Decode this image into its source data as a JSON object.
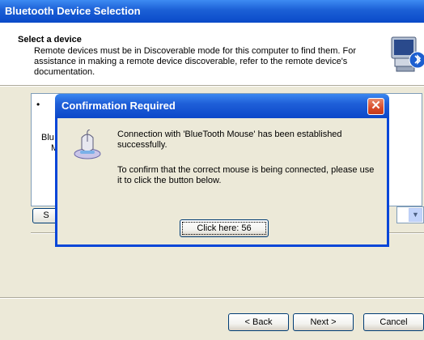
{
  "wizard": {
    "title": "Bluetooth Device Selection",
    "header_title": "Select a device",
    "header_text": "Remote devices must be in Discoverable mode for this computer to find them. For assistance in making a remote device discoverable, refer to the remote device's documentation.",
    "list_fragment_1": "Blu",
    "list_fragment_2": "M",
    "under_button_label": "S",
    "back_label": "< Back",
    "next_label": "Next >",
    "cancel_label": "Cancel"
  },
  "dialog": {
    "title": "Confirmation Required",
    "message_1": "Connection with 'BlueTooth Mouse' has been established successfully.",
    "message_2": "To confirm that the correct mouse is being connected, please use it to click the button below.",
    "button_label": "Click here: 56"
  },
  "colors": {
    "titlebar_blue": "#0a4ac8",
    "dialog_face": "#ece9d8",
    "close_red": "#d84b2a"
  },
  "icons": {
    "header": "computer-bluetooth-icon",
    "dialog": "mouse-icon",
    "close": "close-icon",
    "dropdown": "chevron-down-icon"
  }
}
